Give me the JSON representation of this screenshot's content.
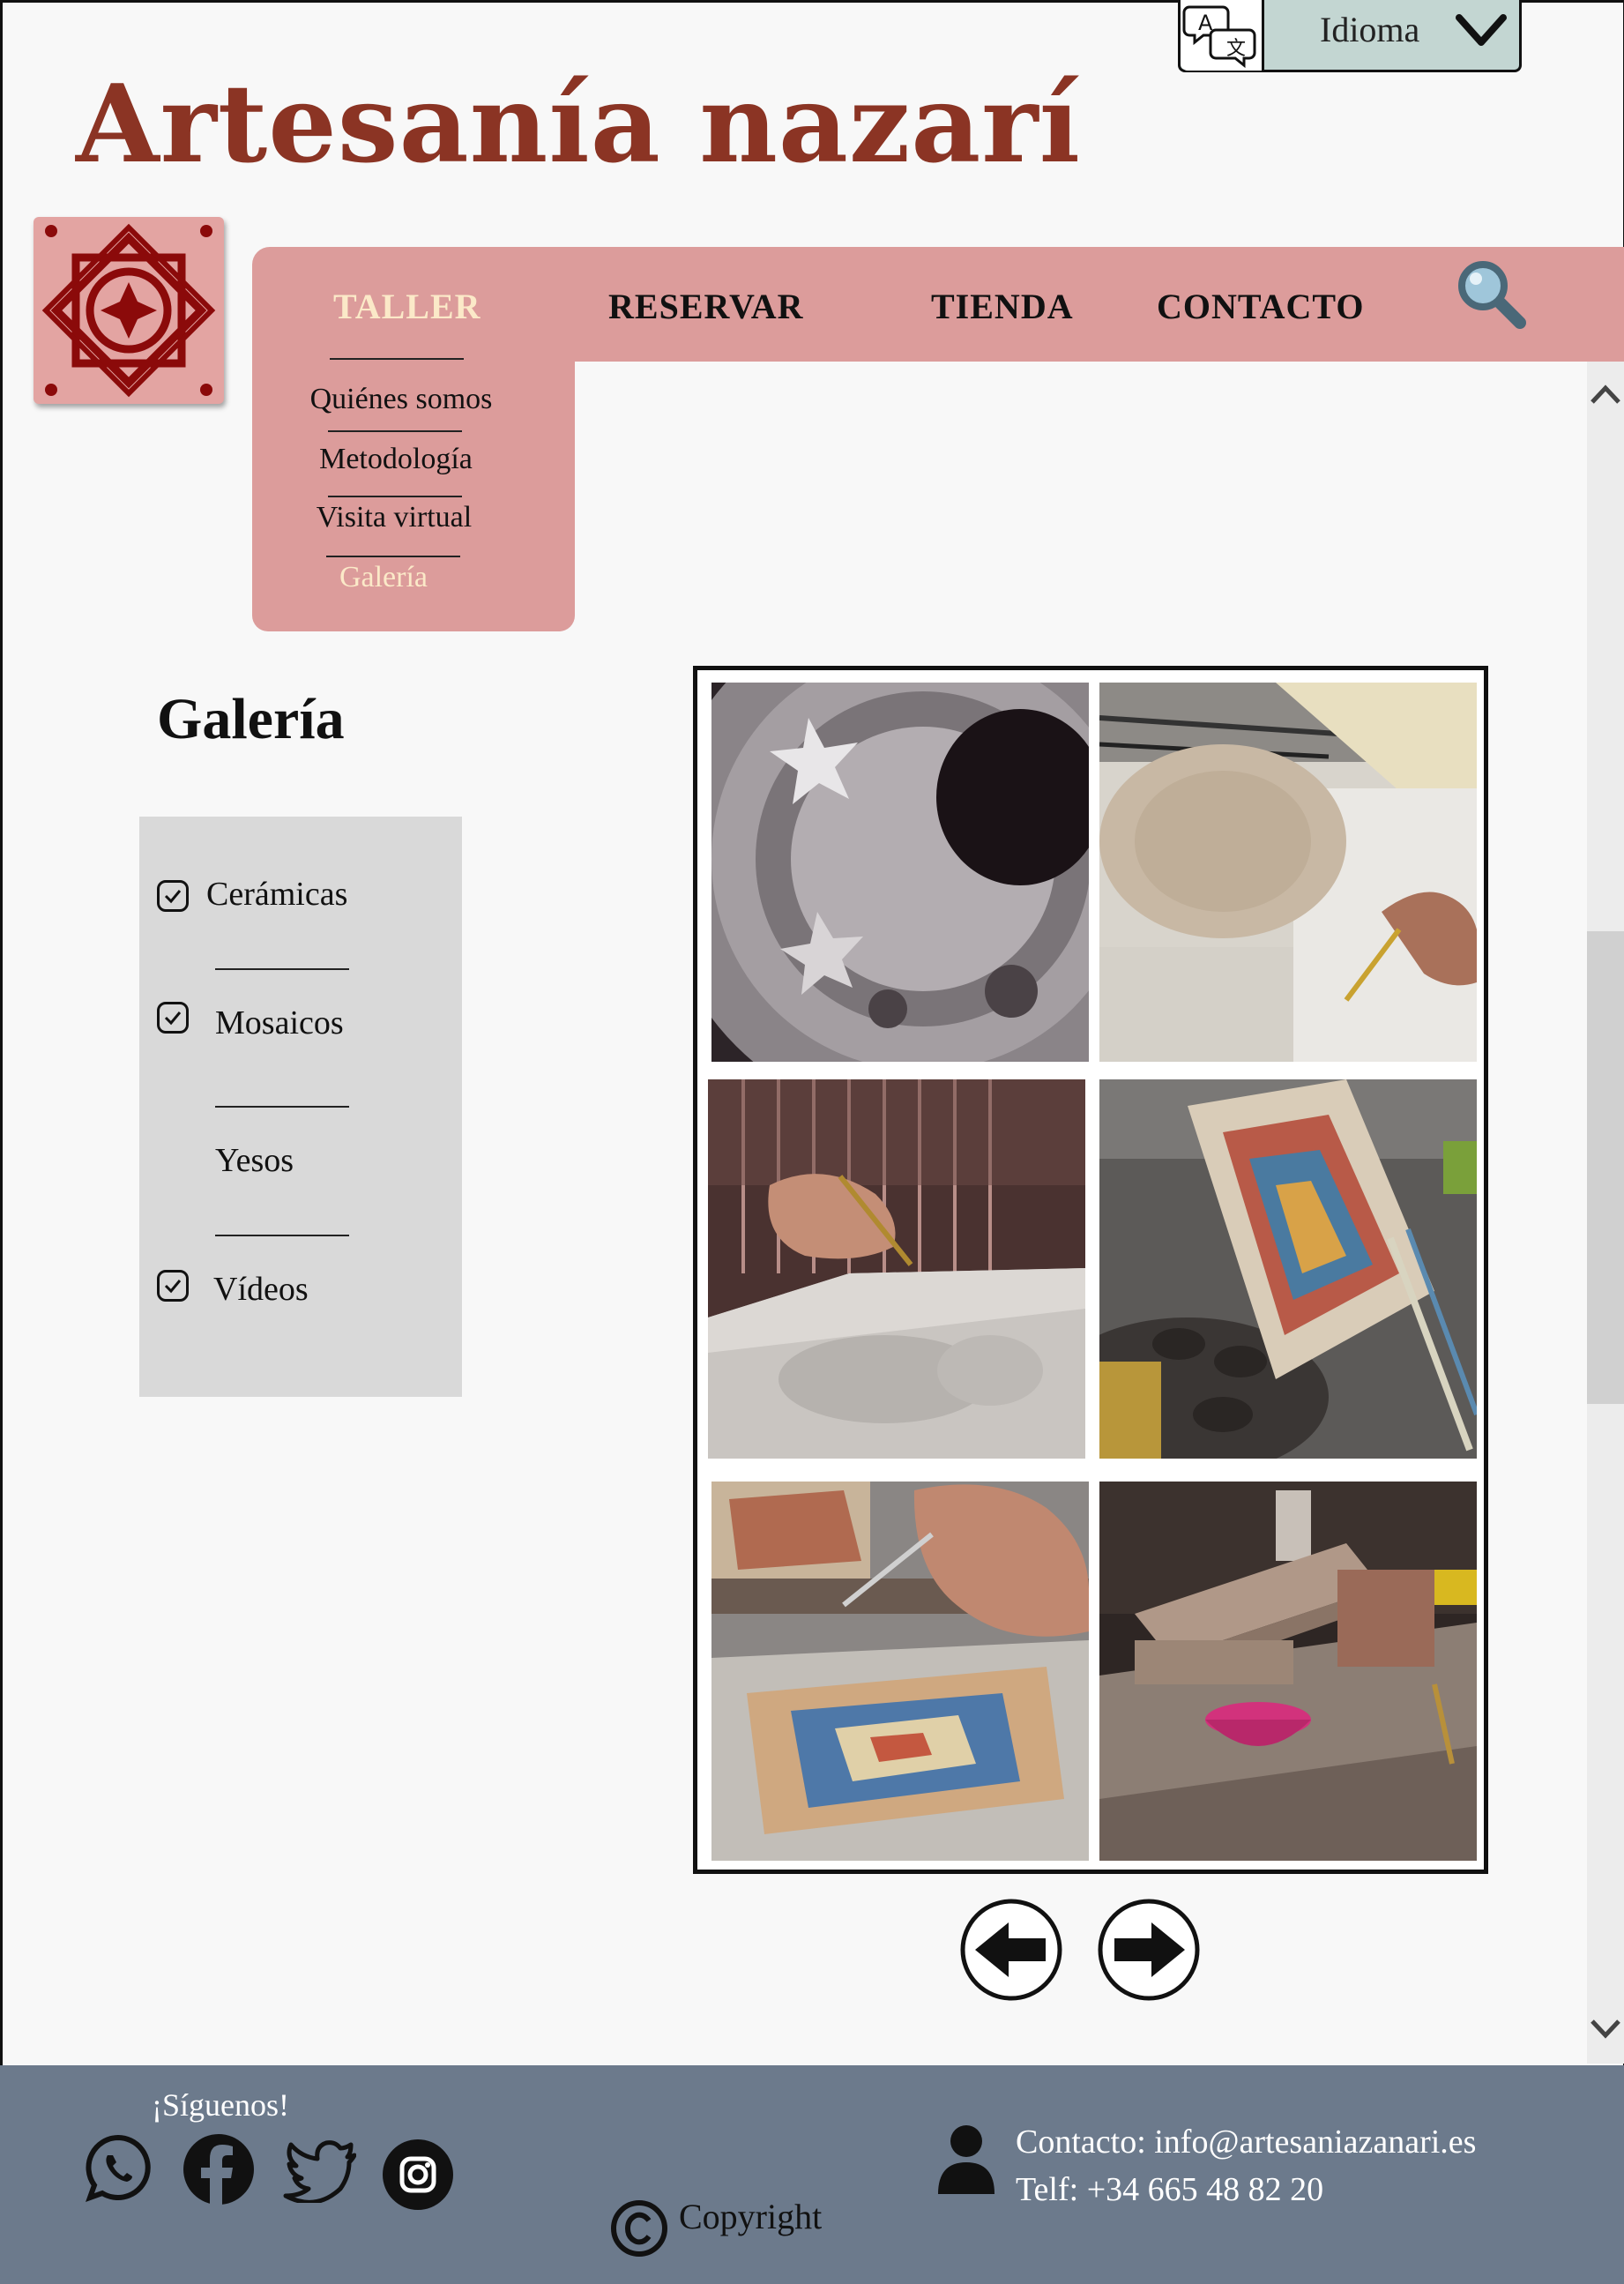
{
  "site": {
    "title": "Artesanía nazarí"
  },
  "language": {
    "label": "Idioma"
  },
  "nav": {
    "items": [
      "TALLER",
      "RESERVAR",
      "TIENDA",
      "CONTACTO"
    ],
    "active": "TALLER",
    "submenu": [
      "Quiénes somos",
      "Metodología",
      "Visita virtual",
      "Galería"
    ],
    "submenu_active": "Galería"
  },
  "gallery": {
    "title": "Galería",
    "filters": [
      {
        "label": "Cerámicas",
        "checked": true
      },
      {
        "label": "Mosaicos",
        "checked": true
      },
      {
        "label": "Yesos",
        "checked": false
      },
      {
        "label": "Vídeos",
        "checked": true
      }
    ],
    "photos": [
      "carved-plaster-rosette-photo",
      "drawing-pattern-on-paper-photo",
      "carving-plaster-tile-photo",
      "painted-plaster-panel-photo",
      "painting-plaster-detail-photo",
      "plaster-block-on-workbench-photo"
    ]
  },
  "footer": {
    "follow": "¡Síguenos!",
    "contact_email": "Contacto: info@artesaniazanari.es",
    "contact_phone": "Telf: +34 665 48 82 20",
    "copyright": "Copyright"
  },
  "colors": {
    "brand": "#8b3424",
    "nav": "#dc9c9b",
    "logo_pattern": "#8b0a0a",
    "footer": "#6c7a8c",
    "lang_bg": "#c3d6d2"
  }
}
